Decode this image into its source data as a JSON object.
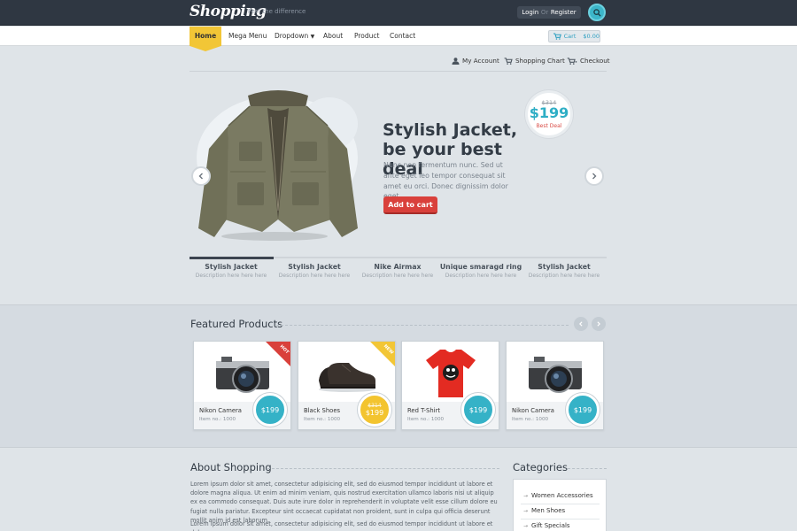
{
  "header": {
    "logo": "Shopping",
    "tagline": "Feel the difference",
    "login": "Login",
    "or": "Or",
    "register": "Register",
    "search_icon": "search-icon"
  },
  "nav": {
    "items": [
      "Home",
      "Mega Menu",
      "Dropdown",
      "About",
      "Product",
      "Contact"
    ],
    "cart_label": "Cart",
    "cart_total": "$0.00"
  },
  "account": {
    "my_account": "My Account",
    "shopping_chart": "Shopping Chart",
    "checkout": "Checkout"
  },
  "hero": {
    "title_line1": "Stylish Jacket,",
    "title_line2": "be your best deal",
    "description": "Nunc non fermentum nunc. Sed ut ante eget leo tempor consequat sit amet eu orci. Donec dignissim dolor eget..",
    "button": "Add to cart",
    "old_price": "$314",
    "price": "$199",
    "badge_label": "Best Deal"
  },
  "slider_tabs": [
    {
      "title": "Stylish Jacket",
      "desc": "Description here here here"
    },
    {
      "title": "Stylish Jacket",
      "desc": "Description here here here"
    },
    {
      "title": "Nike Airmax",
      "desc": "Description here here here"
    },
    {
      "title": "Unique smaragd ring",
      "desc": "Description here here here"
    },
    {
      "title": "Stylish Jacket",
      "desc": "Description here here here"
    }
  ],
  "featured": {
    "title": "Featured Products",
    "products": [
      {
        "name": "Nikon Camera",
        "item": "Item no.: 1000",
        "price": "$199",
        "old_price": "",
        "ribbon": "HOT"
      },
      {
        "name": "Black Shoes",
        "item": "Item no.: 1000",
        "price": "$199",
        "old_price": "$314",
        "ribbon": "NEW"
      },
      {
        "name": "Red T-Shirt",
        "item": "Item no.: 1000",
        "price": "$199",
        "old_price": "",
        "ribbon": ""
      },
      {
        "name": "Nikon Camera",
        "item": "Item no.: 1000",
        "price": "$199",
        "old_price": "",
        "ribbon": ""
      }
    ]
  },
  "about": {
    "title": "About Shopping",
    "p1": "Lorem ipsum dolor sit amet, consectetur adipisicing elit, sed do eiusmod tempor incididunt ut labore et dolore magna aliqua. Ut enim ad minim veniam, quis nostrud exercitation ullamco laboris nisi ut aliquip ex ea commodo consequat. Duis aute irure dolor in reprehenderit in voluptate velit esse cillum dolore eu fugiat nulla pariatur. Excepteur sint occaecat cupidatat non proident, sunt in culpa qui officia deserunt mollit anim id est laborum.",
    "p2": "Lorem ipsum dolor sit amet, consectetur adipisicing elit, sed do eiusmod tempor incididunt ut labore et dolore magna"
  },
  "categories": {
    "title": "Categories",
    "items": [
      "Women Accessories",
      "Men Shoes",
      "Gift Specials"
    ]
  },
  "colors": {
    "accent_teal": "#35b2c7",
    "accent_yellow": "#f2c636",
    "accent_red": "#d9403b",
    "dark_header": "#2f3742"
  }
}
